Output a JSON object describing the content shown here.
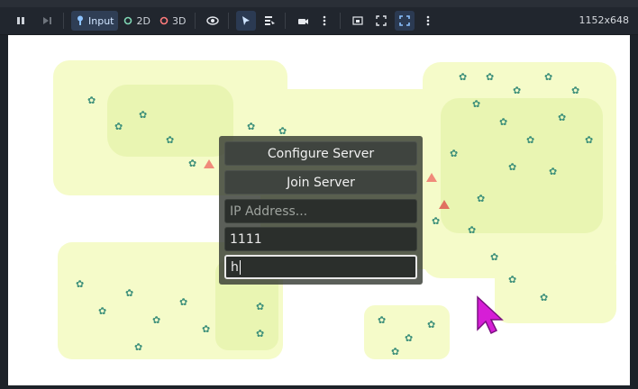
{
  "toolbar": {
    "input_label": "Input",
    "mode_2d_label": "2D",
    "mode_3d_label": "3D",
    "resolution": "1152x648"
  },
  "dialog": {
    "configure_server_label": "Configure Server",
    "join_server_label": "Join Server",
    "ip_placeholder": "IP Address...",
    "port_value": "1111",
    "name_value": "h"
  },
  "colors": {
    "accent": "#2f3e55",
    "cursor": "#d61ed6",
    "land": "#f5fbc9"
  }
}
